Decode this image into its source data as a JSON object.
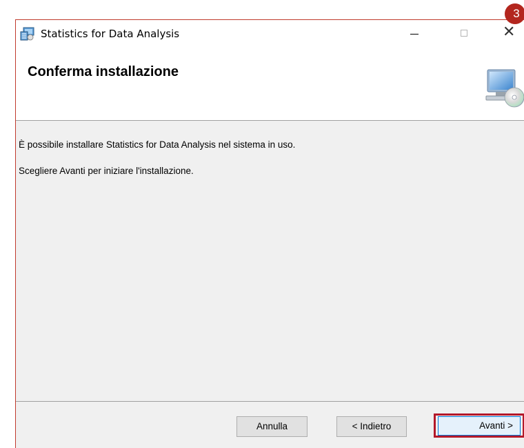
{
  "window": {
    "title": "Statistics for Data Analysis",
    "controls": {
      "close_glyph": "✕"
    }
  },
  "header": {
    "title": "Conferma installazione",
    "icon": "computer-cd-icon"
  },
  "content": {
    "line1": "È possibile installare Statistics for Data Analysis nel sistema in uso.",
    "line2": "Scegliere Avanti per iniziare l'installazione."
  },
  "footer": {
    "cancel_label": "Annulla",
    "back_label": "< Indietro",
    "next_label": "Avanti >"
  },
  "annotation": {
    "step_number": "3",
    "highlight_color": "#b3182a"
  }
}
